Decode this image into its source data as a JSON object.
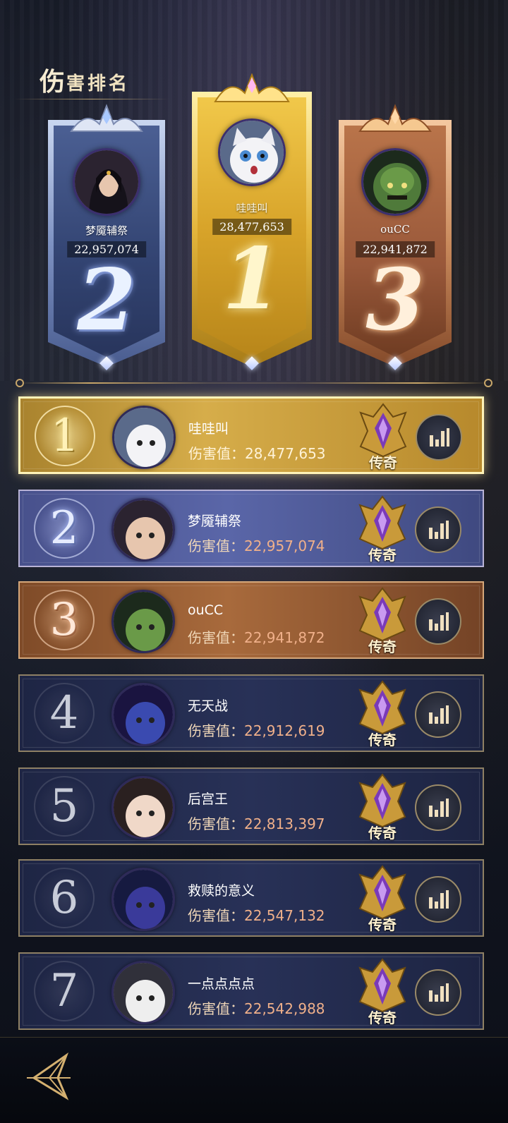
{
  "title": {
    "first_char": "伤",
    "rest": "害排名"
  },
  "podium": [
    {
      "rank": "2",
      "name": "梦魇辅祭",
      "score": "22,957,074"
    },
    {
      "rank": "1",
      "name": "哇哇叫",
      "score": "28,477,653"
    },
    {
      "rank": "3",
      "name": "ouCC",
      "score": "22,941,872"
    }
  ],
  "damage_label": "伤害值：",
  "emblem_label": "传奇",
  "list": [
    {
      "rank": "1",
      "name": "哇哇叫",
      "damage": "28,477,653",
      "emblem": "传奇"
    },
    {
      "rank": "2",
      "name": "梦魇辅祭",
      "damage": "22,957,074",
      "emblem": "传奇"
    },
    {
      "rank": "3",
      "name": "ouCC",
      "damage": "22,941,872",
      "emblem": "传奇"
    },
    {
      "rank": "4",
      "name": "无天战",
      "damage": "22,912,619",
      "emblem": "传奇"
    },
    {
      "rank": "5",
      "name": "后宫王",
      "damage": "22,813,397",
      "emblem": "传奇"
    },
    {
      "rank": "6",
      "name": "救赎的意义",
      "damage": "22,547,132",
      "emblem": "传奇"
    },
    {
      "rank": "7",
      "name": "一点点点点",
      "damage": "22,542,988",
      "emblem": "传奇"
    }
  ],
  "icons": {
    "stats": "bar-chart-icon",
    "back": "back-arrow-icon",
    "emblem": "legend-emblem-icon"
  },
  "colors": {
    "gold": "#d6ad4a",
    "silver": "#5a66a8",
    "bronze": "#a86a3c",
    "damage_value": "#f0b08a"
  }
}
